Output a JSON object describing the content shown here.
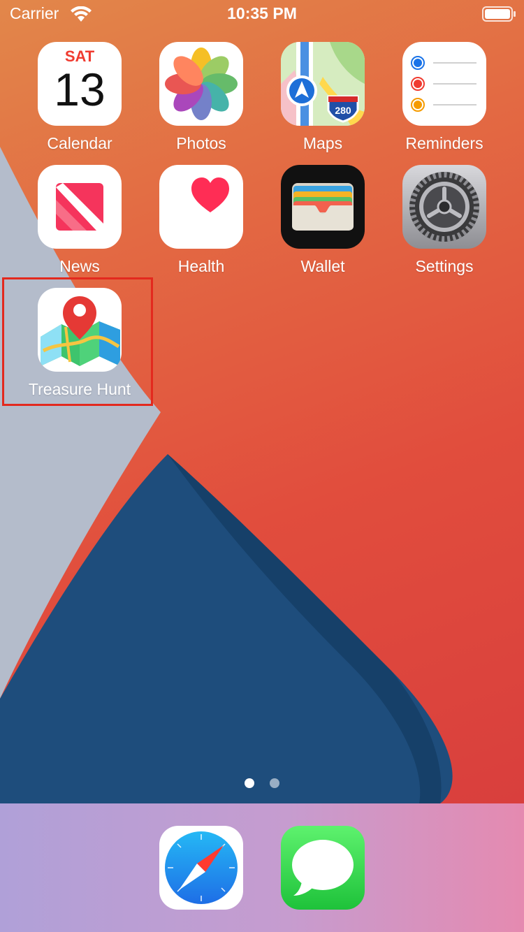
{
  "status_bar": {
    "carrier": "Carrier",
    "time": "10:35 PM",
    "icons": [
      "wifi-icon",
      "battery-icon"
    ]
  },
  "apps": [
    {
      "label": "Calendar",
      "icon": "calendar-icon",
      "day": "SAT",
      "date": "13"
    },
    {
      "label": "Photos",
      "icon": "photos-icon"
    },
    {
      "label": "Maps",
      "icon": "maps-icon",
      "highway_shield": "280"
    },
    {
      "label": "Reminders",
      "icon": "reminders-icon"
    },
    {
      "label": "News",
      "icon": "news-icon"
    },
    {
      "label": "Health",
      "icon": "health-icon"
    },
    {
      "label": "Wallet",
      "icon": "wallet-icon"
    },
    {
      "label": "Settings",
      "icon": "settings-icon"
    },
    {
      "label": "Treasure Hunt",
      "icon": "treasure-hunt-icon",
      "highlighted": true
    }
  ],
  "page_indicator": {
    "pages": 2,
    "current": 1
  },
  "dock": [
    {
      "name": "Safari",
      "icon": "safari-icon"
    },
    {
      "name": "Messages",
      "icon": "messages-icon"
    }
  ],
  "colors": {
    "highlight": "#e3291e",
    "calendar_red": "#f03b30"
  }
}
